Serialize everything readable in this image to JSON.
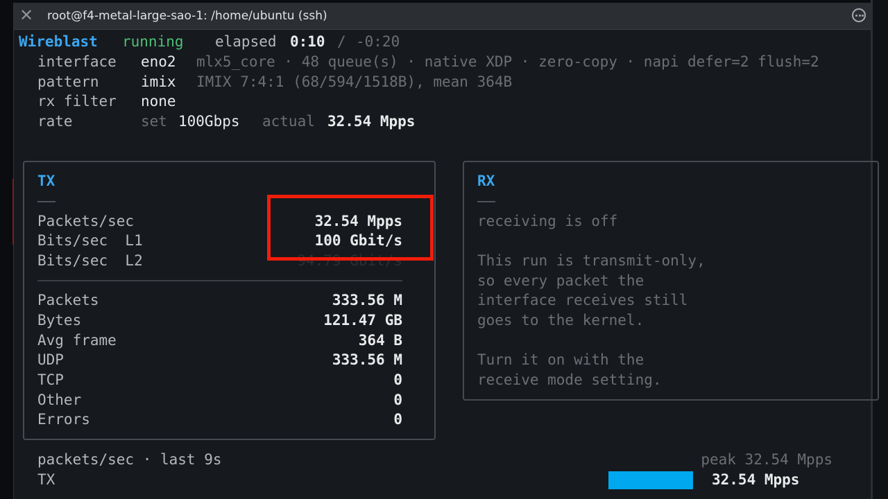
{
  "window": {
    "title": "root@f4-metal-large-sao-1: /home/ubuntu (ssh)",
    "close_glyph": "✕",
    "more_icon": "ellipsis-circle-icon"
  },
  "header": {
    "app_name": "Wireblast",
    "status": "running",
    "elapsed_label": "elapsed",
    "elapsed_value": "0:10",
    "elapsed_sep": "/",
    "remaining": "-0:20",
    "interface": {
      "label": "interface",
      "value": "eno2",
      "detail": "mlx5_core · 48 queue(s) · native XDP · zero-copy · napi defer=2 flush=2"
    },
    "pattern": {
      "label": "pattern",
      "value": "imix",
      "detail": "IMIX 7:4:1 (68/594/1518B), mean 364B"
    },
    "rx_filter": {
      "label": "rx filter",
      "value": "none"
    },
    "rate": {
      "label": "rate",
      "set_label": "set",
      "set_value": "100Gbps",
      "actual_label": "actual",
      "actual_value": "32.54 Mpps"
    }
  },
  "tx_panel": {
    "title": "TX",
    "rates": [
      {
        "label": "Packets/sec",
        "value": "32.54 Mpps"
      },
      {
        "label": "Bits/sec  L1",
        "value": "100 Gbit/s"
      },
      {
        "label": "Bits/sec  L2",
        "value": "94.79 Gbit/s"
      }
    ],
    "counters": [
      {
        "label": "Packets",
        "value": "333.56 M"
      },
      {
        "label": "Bytes",
        "value": "121.47 GB"
      },
      {
        "label": "Avg frame",
        "value": "364 B"
      },
      {
        "label": "UDP",
        "value": "333.56 M"
      },
      {
        "label": "TCP",
        "value": "0"
      },
      {
        "label": "Other",
        "value": "0"
      },
      {
        "label": "Errors",
        "value": "0"
      }
    ]
  },
  "rx_panel": {
    "title": "RX",
    "status": "receiving is off",
    "explanation": [
      "This run is transmit-only,",
      "so every packet the",
      "interface receives still",
      "goes to the kernel."
    ],
    "hint": [
      "Turn it on with the",
      "receive mode setting."
    ]
  },
  "sparkline": {
    "title": "packets/sec · last 9s",
    "peak_label": "peak 32.54 Mpps",
    "series_label": "TX",
    "current_value": "32.54 Mpps",
    "bar_level": 1.0,
    "bar_color": "#00a8ef"
  },
  "colors": {
    "accent_blue": "#3ba7f0",
    "status_green": "#4fbf78",
    "highlight_red": "#f11d0b",
    "background": "#16191d"
  }
}
